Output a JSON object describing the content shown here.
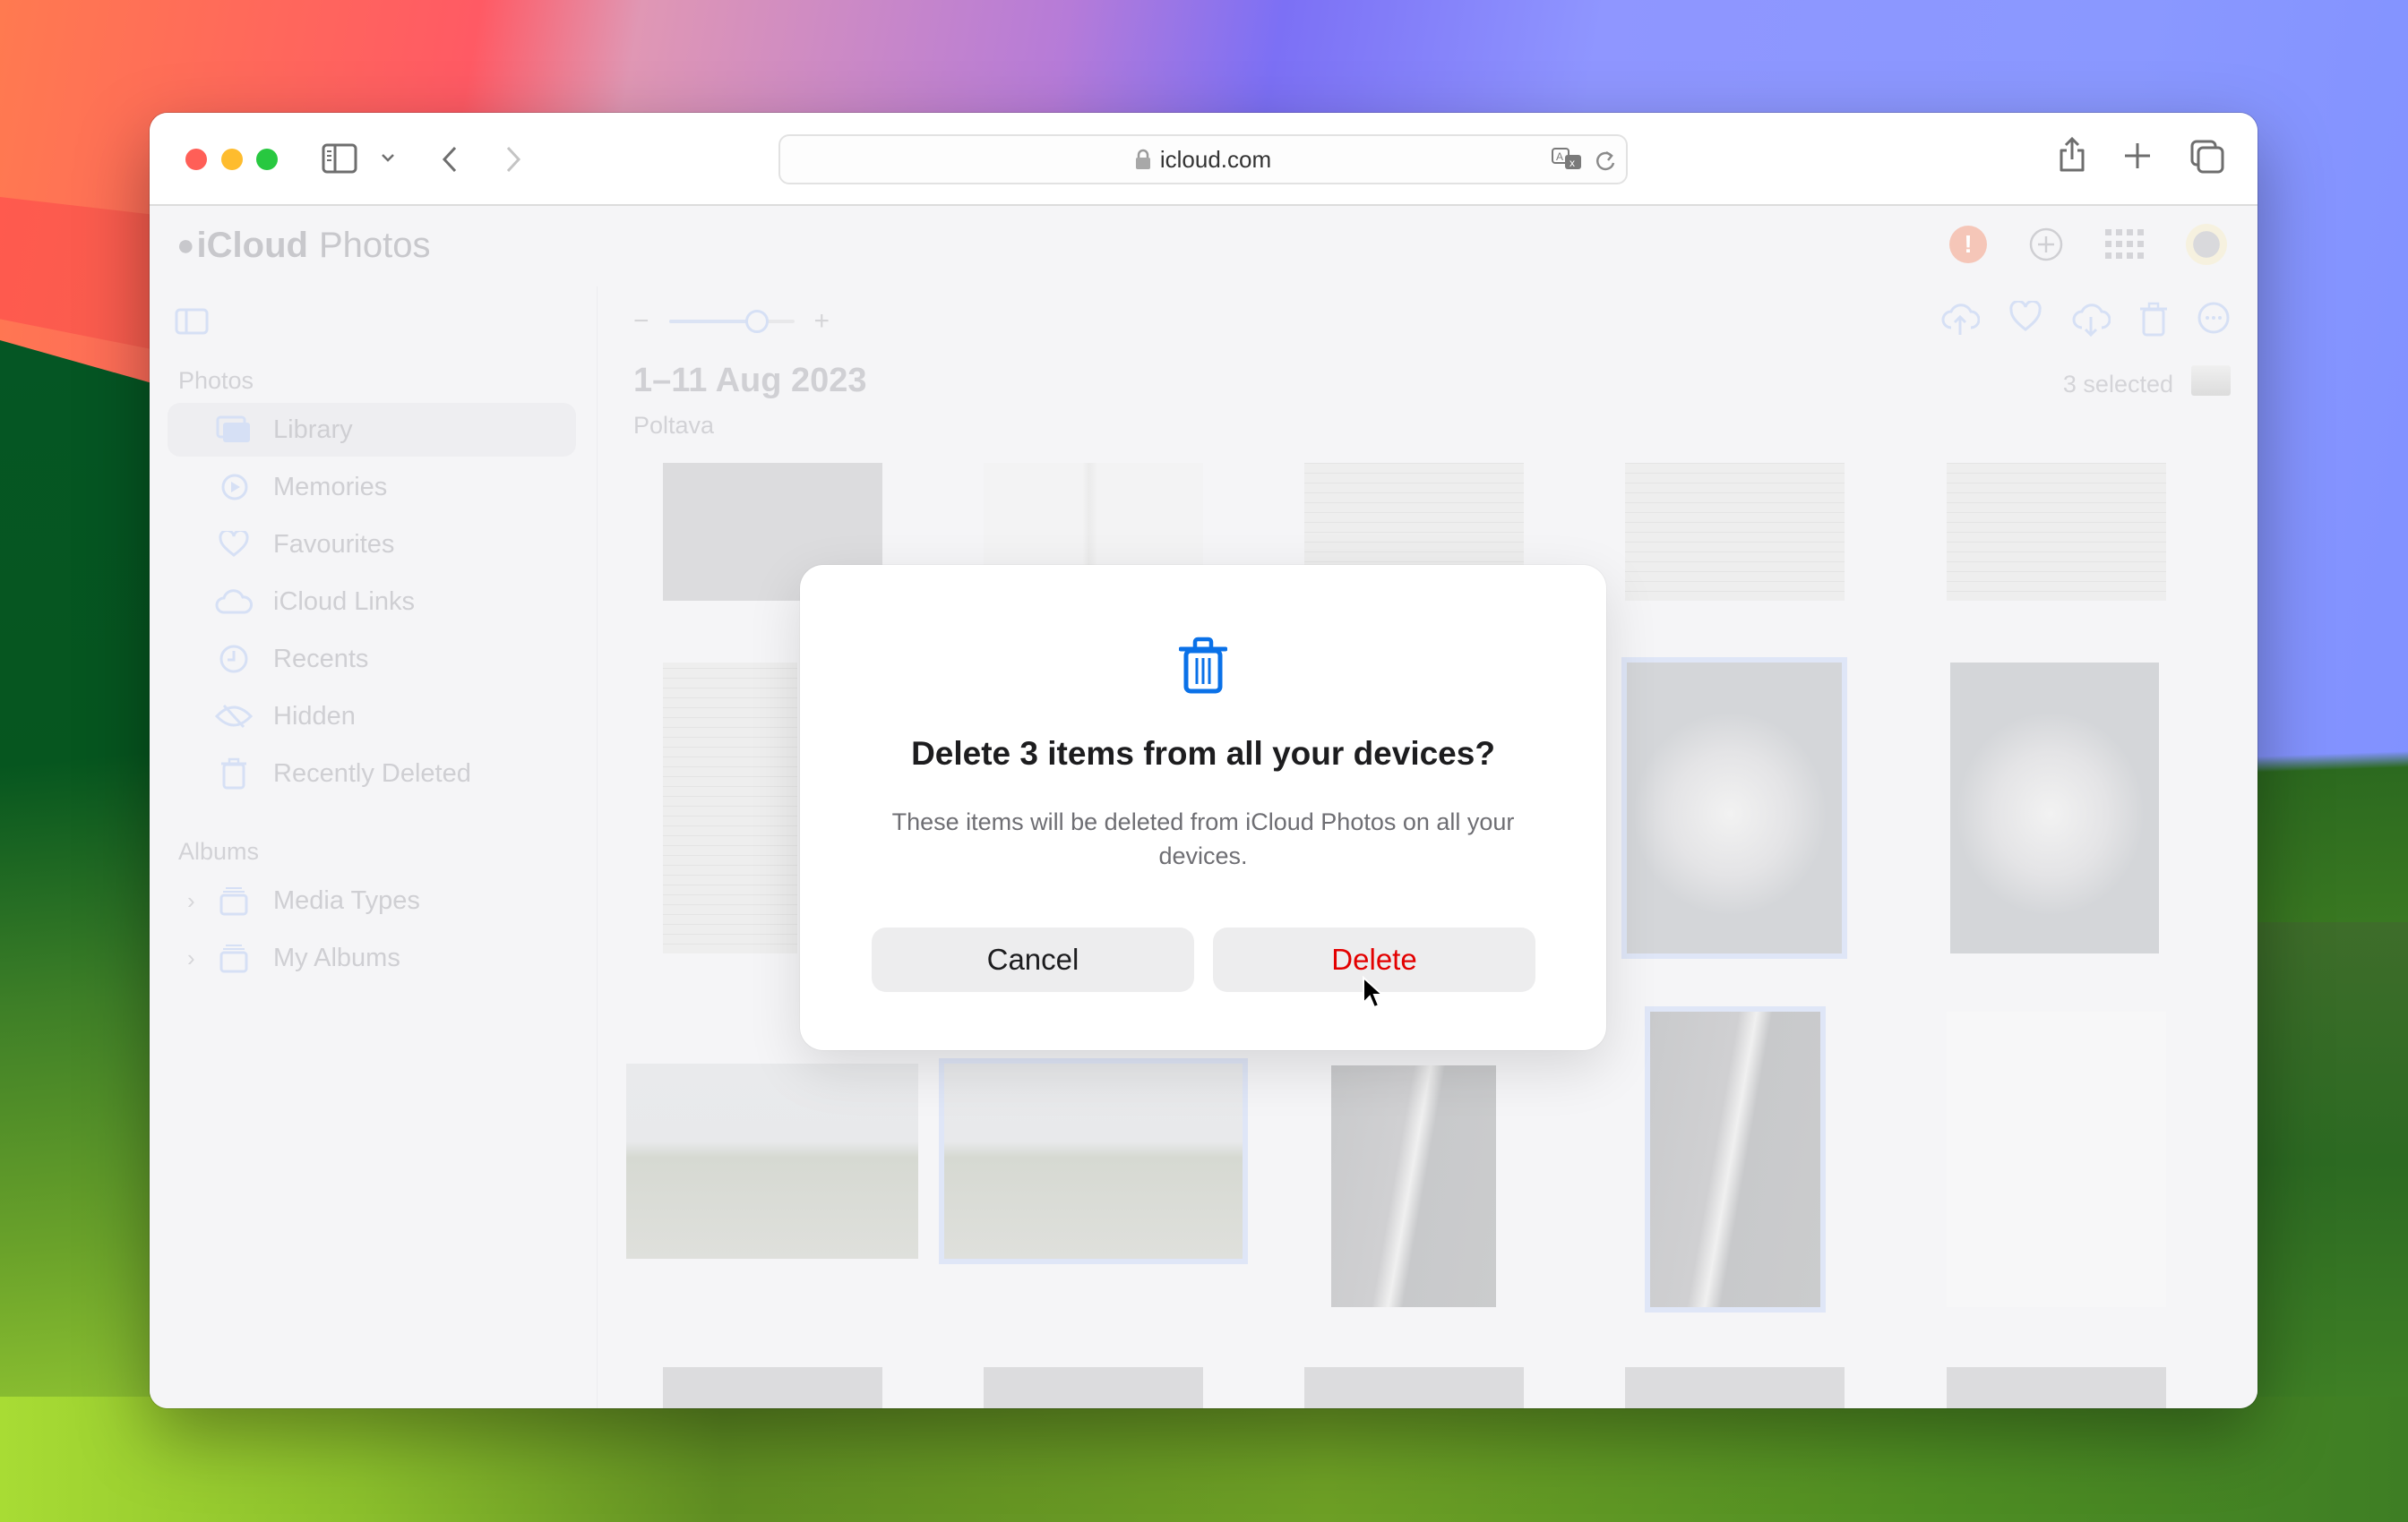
{
  "browser": {
    "url": "icloud.com",
    "buttons": {
      "close": "close",
      "minimize": "minimize",
      "maximize": "maximize",
      "sidebar": "sidebar-toggle",
      "back": "back",
      "forward": "forward",
      "share": "share",
      "new_tab": "new-tab",
      "tab_overview": "tab-overview"
    }
  },
  "app": {
    "brand_logo": "",
    "brand_bold": "iCloud",
    "brand_light": "Photos",
    "header_icons": [
      "alert-icon",
      "add-icon",
      "apps-grid-icon",
      "avatar"
    ]
  },
  "sidebar": {
    "sections": [
      {
        "title": "Photos",
        "items": [
          {
            "label": "Library",
            "icon": "library-icon",
            "active": true
          },
          {
            "label": "Memories",
            "icon": "memories-icon"
          },
          {
            "label": "Favourites",
            "icon": "heart-icon"
          },
          {
            "label": "iCloud Links",
            "icon": "cloud-link-icon"
          },
          {
            "label": "Recents",
            "icon": "clock-icon"
          },
          {
            "label": "Hidden",
            "icon": "eye-slash-icon"
          },
          {
            "label": "Recently Deleted",
            "icon": "trash-icon"
          }
        ]
      },
      {
        "title": "Albums",
        "items": [
          {
            "label": "Media Types",
            "icon": "album-stack-icon",
            "expandable": true
          },
          {
            "label": "My Albums",
            "icon": "album-stack-icon",
            "expandable": true
          }
        ]
      }
    ]
  },
  "main": {
    "zoom_minus": "−",
    "zoom_plus": "+",
    "zoom_level": 0.7,
    "date_title": "1–11 Aug 2023",
    "location": "Poltava",
    "selected_count": "3 selected",
    "action_icons": [
      "upload-icon",
      "favourite-icon",
      "download-icon",
      "delete-icon",
      "more-icon"
    ],
    "photos": [
      {
        "kind": "gray",
        "selected": false
      },
      {
        "kind": "bottle",
        "selected": false
      },
      {
        "kind": "doc",
        "selected": false
      },
      {
        "kind": "doc",
        "selected": false
      },
      {
        "kind": "doc",
        "selected": false
      },
      {
        "kind": "doc",
        "selected": false
      },
      {
        "kind": "hidden",
        "selected": false
      },
      {
        "kind": "hidden",
        "selected": false
      },
      {
        "kind": "cat",
        "selected": true
      },
      {
        "kind": "cat",
        "selected": false
      },
      {
        "kind": "field",
        "selected": false
      },
      {
        "kind": "field",
        "selected": true
      },
      {
        "kind": "waterfall",
        "selected": false
      },
      {
        "kind": "waterfall",
        "selected": true
      },
      {
        "kind": "blank-doc",
        "selected": false
      },
      {
        "kind": "gray",
        "selected": false
      },
      {
        "kind": "gray",
        "selected": false
      },
      {
        "kind": "gray",
        "selected": false
      },
      {
        "kind": "gray",
        "selected": false
      },
      {
        "kind": "gray",
        "selected": false
      }
    ]
  },
  "dialog": {
    "icon": "trash-icon",
    "title": "Delete 3 items from all your devices?",
    "message": "These items will be deleted from iCloud Photos on all your devices.",
    "cancel_label": "Cancel",
    "delete_label": "Delete",
    "colors": {
      "icon": "#0a71e8",
      "delete_text": "#e30000",
      "button_bg": "#ededee"
    }
  }
}
